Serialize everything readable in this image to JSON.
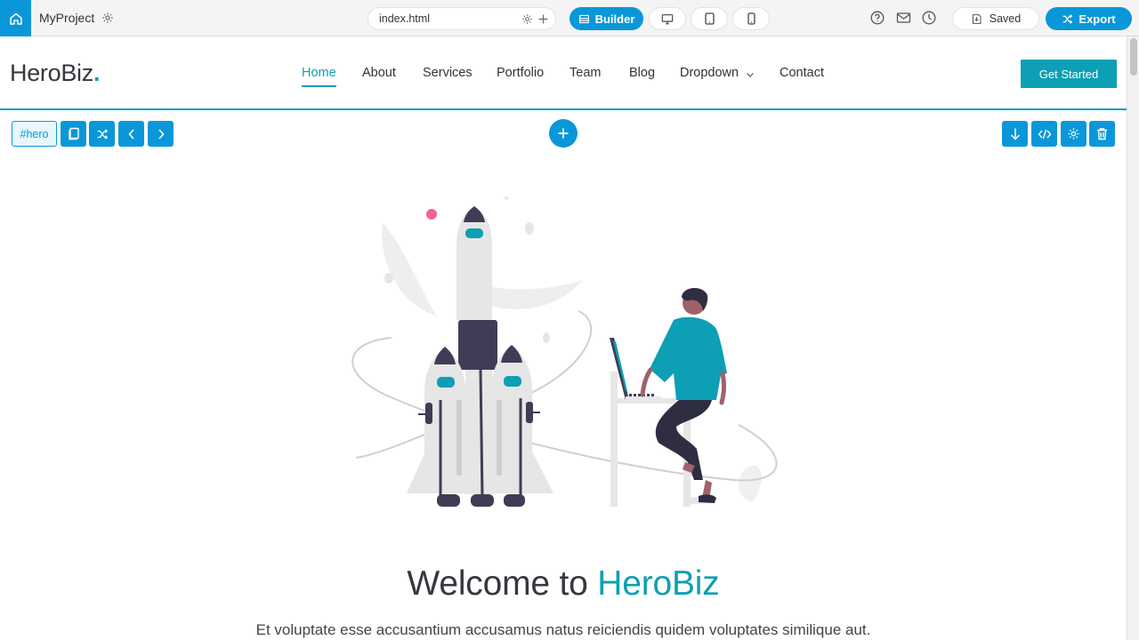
{
  "toolbar": {
    "project_name": "MyProject",
    "file_name": "index.html",
    "builder_label": "Builder",
    "saved_label": "Saved",
    "export_label": "Export"
  },
  "site": {
    "logo_text": "HeroBiz",
    "logo_dot": ".",
    "nav": [
      "Home",
      "About",
      "Services",
      "Portfolio",
      "Team",
      "Blog",
      "Dropdown",
      "Contact"
    ],
    "active_nav": "Home",
    "cta_label": "Get Started"
  },
  "section": {
    "tag": "#hero"
  },
  "hero": {
    "title_prefix": "Welcome to ",
    "title_accent": "HeroBiz",
    "subtitle": "Et voluptate esse accusantium accusamus natus reiciendis quidem voluptates similique aut."
  },
  "colors": {
    "builder_blue": "#0a97d9",
    "site_accent": "#0d9fb5",
    "text_dark": "#37373f"
  },
  "icons": {
    "home": "home-icon",
    "gear": "gear-icon",
    "plus": "plus-icon",
    "builder": "layers-icon",
    "desktop": "desktop-icon",
    "tablet": "tablet-icon",
    "mobile": "mobile-icon",
    "help": "help-icon",
    "mail": "mail-icon",
    "history": "history-icon",
    "save": "save-icon",
    "export": "shuffle-icon"
  }
}
